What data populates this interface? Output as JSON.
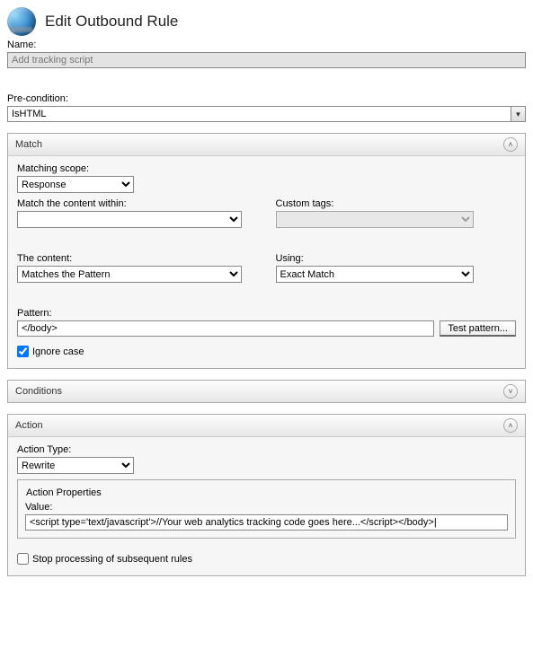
{
  "header": {
    "title": "Edit Outbound Rule"
  },
  "name": {
    "label": "Name:",
    "value": "Add tracking script"
  },
  "precondition": {
    "label": "Pre-condition:",
    "value": "IsHTML"
  },
  "match": {
    "title": "Match",
    "scope_label": "Matching scope:",
    "scope_value": "Response",
    "content_within_label": "Match the content within:",
    "content_within_value": "",
    "custom_tags_label": "Custom tags:",
    "custom_tags_value": "",
    "content_label": "The content:",
    "content_value": "Matches the Pattern",
    "using_label": "Using:",
    "using_value": "Exact Match",
    "pattern_label": "Pattern:",
    "pattern_value": "</body>",
    "test_button": "Test pattern...",
    "ignore_case_label": "Ignore case"
  },
  "conditions": {
    "title": "Conditions"
  },
  "action": {
    "title": "Action",
    "type_label": "Action Type:",
    "type_value": "Rewrite",
    "properties_title": "Action Properties",
    "value_label": "Value:",
    "value_text": "<script type='text/javascript'>//Your web analytics tracking code goes here...</script></body>|",
    "stop_label": "Stop processing of subsequent rules"
  }
}
